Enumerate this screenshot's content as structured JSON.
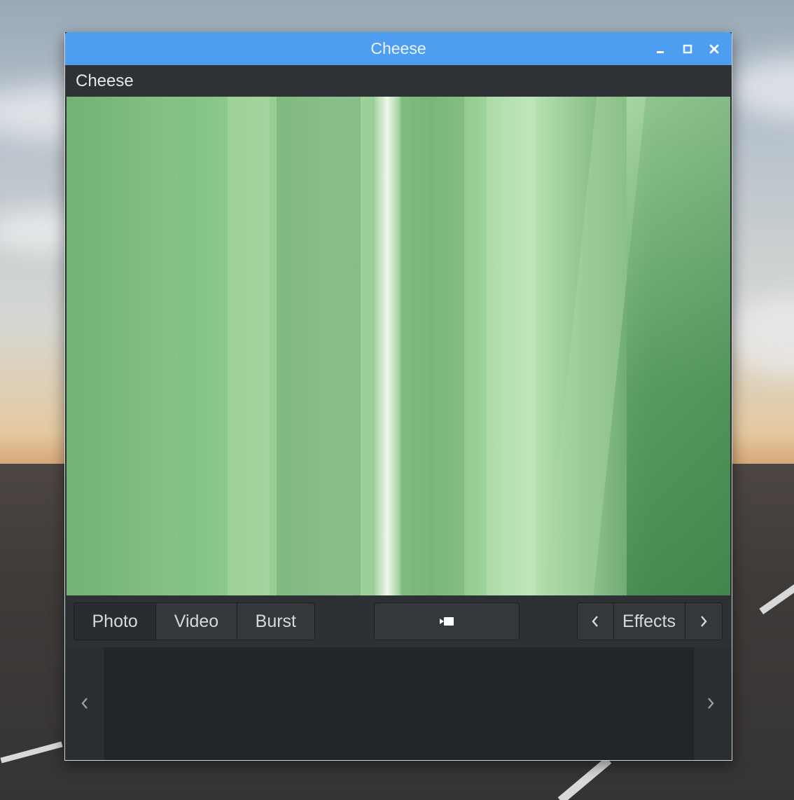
{
  "window": {
    "title": "Cheese"
  },
  "header": {
    "app_title": "Cheese"
  },
  "modes": [
    {
      "label": "Photo",
      "active": true
    },
    {
      "label": "Video",
      "active": false
    },
    {
      "label": "Burst",
      "active": false
    }
  ],
  "capture": {
    "icon": "video-camera-icon"
  },
  "effects": {
    "label": "Effects"
  },
  "colors": {
    "titlebar": "#4d9ef0",
    "window_bg": "#2b2e30",
    "text": "#d8d8d8"
  }
}
